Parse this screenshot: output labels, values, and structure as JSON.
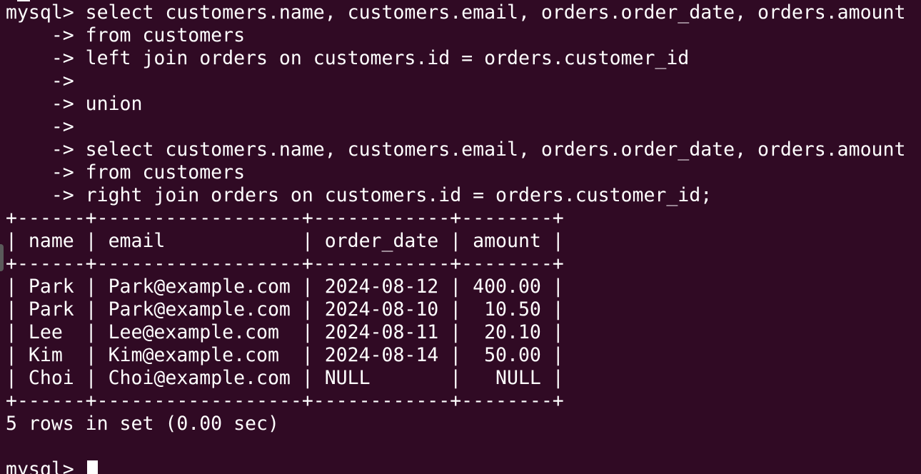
{
  "terminal": {
    "cursor_color": "#ffffff",
    "lines": [
      "mysql> select customers.name, customers.email, orders.order_date, orders.amount",
      "    -> from customers",
      "    -> left join orders on customers.id = orders.customer_id",
      "    ->",
      "    -> union",
      "    ->",
      "    -> select customers.name, customers.email, orders.order_date, orders.amount",
      "    -> from customers",
      "    -> right join orders on customers.id = orders.customer_id;",
      "+------+------------------+------------+--------+",
      "| name | email            | order_date | amount |",
      "+------+------------------+------------+--------+",
      "| Park | Park@example.com | 2024-08-12 | 400.00 |",
      "| Park | Park@example.com | 2024-08-10 |  10.50 |",
      "| Lee  | Lee@example.com  | 2024-08-11 |  20.10 |",
      "| Kim  | Kim@example.com  | 2024-08-14 |  50.00 |",
      "| Choi | Choi@example.com | NULL       |   NULL |",
      "+------+------------------+------------+--------+",
      "5 rows in set (0.00 sec)",
      ""
    ],
    "prompt": "mysql> "
  }
}
